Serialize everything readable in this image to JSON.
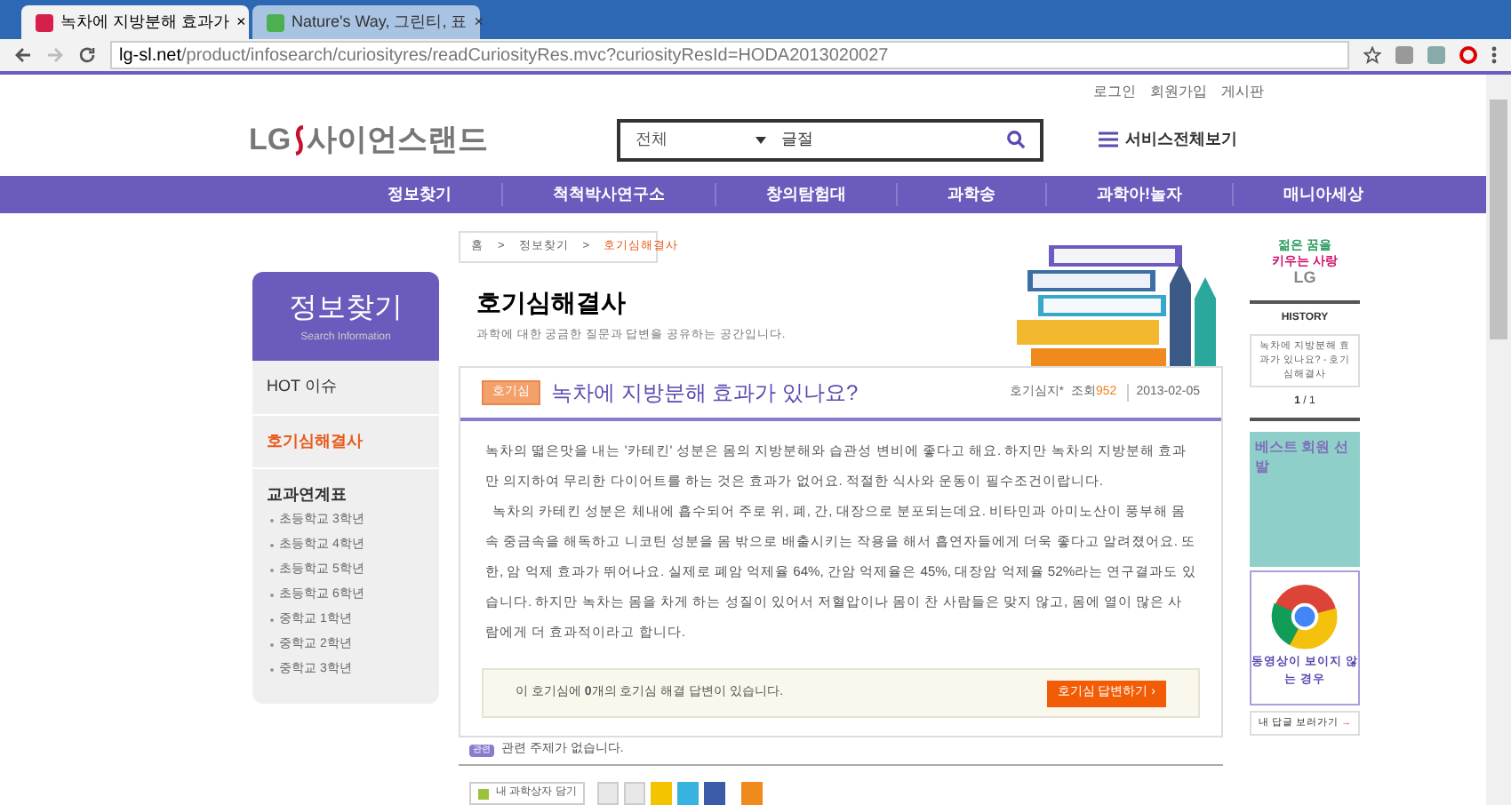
{
  "browser": {
    "tabs": [
      {
        "title": "녹차에 지방분해 효과가",
        "selected": true
      },
      {
        "title": "Nature's Way, 그린티, 표",
        "selected": false
      }
    ],
    "close_glyph": "×",
    "url_host": "lg-sl.net",
    "url_path": "/product/infosearch/curiosityres/readCuriosityRes.mvc?curiosityResId=HODA2013020027"
  },
  "top_links": [
    "로그인",
    "회원가입",
    "게시판"
  ],
  "logo": {
    "brand": "LG",
    "name": "사이언스랜드"
  },
  "search": {
    "category": "전체",
    "value": "글절"
  },
  "service_menu": "서비스전체보기",
  "nav": [
    {
      "label": "정보찾기"
    },
    {
      "label": "척척박사연구소"
    },
    {
      "label": "창의탐험대"
    },
    {
      "label": "과학송"
    },
    {
      "label": "과학아!놀자"
    },
    {
      "label": "매니아세상"
    }
  ],
  "sidebar": {
    "title": "정보찾기",
    "subtitle": "Search Information",
    "items": [
      {
        "label": "HOT 이슈",
        "selected": false
      },
      {
        "label": "호기심해결사",
        "selected": true
      },
      {
        "label": "교과연계표",
        "selected": false,
        "children": [
          {
            "label": "초등학교 3학년"
          },
          {
            "label": "초등학교 4학년"
          },
          {
            "label": "초등학교 5학년"
          },
          {
            "label": "초등학교 6학년"
          },
          {
            "label": "중학교 1학년"
          },
          {
            "label": "중학교 2학년"
          },
          {
            "label": "중학교 3학년"
          }
        ]
      }
    ]
  },
  "breadcrumb": {
    "items": [
      "홈",
      "정보찾기",
      "호기심해결사"
    ],
    "separator": ">"
  },
  "page_title": "호기심해결사",
  "page_subtitle": "과학에 대한 궁금한 질문과 답변을 공유하는 공간입니다.",
  "article": {
    "badge": "호기심",
    "title": "녹차에 지방분해 효과가 있나요?",
    "author": "호기심지*",
    "views_label": "조회",
    "views": "952",
    "date": "2013-02-05",
    "paragraphs": [
      "녹차의 떫은맛을 내는 '카테킨' 성분은 몸의 지방분해와 습관성 변비에 좋다고 해요. 하지만 녹차의 지방분해 효과만 의지하여 무리한 다이어트를 하는 것은 효과가 없어요. 적절한 식사와 운동이 필수조건이랍니다.",
      "녹차의 카테킨 성분은 체내에 흡수되어 주로 위, 폐, 간, 대장으로 분포되는데요. 비타민과 아미노산이 풍부해 몸속 중금속을 해독하고 니코틴 성분을 몸 밖으로 배출시키는 작용을 해서 흡연자들에게 더욱 좋다고 알려졌어요. 또한, 암 억제 효과가 뛰어나요. 실제로 폐암 억제율 64%, 간암 억제율은 45%, 대장암 억제율 52%라는 연구결과도 있습니다. 하지만 녹차는 몸을 차게 하는 성질이 있어서 저혈압이나 몸이 찬 사람들은 맞지 않고, 몸에 열이 많은 사람에게 더 효과적이라고 합니다."
    ],
    "answer_notice": "이 호기심에 **0**개의 호기심 해결 답변이 있습니다.",
    "answer_button": "호기심 답변하기 ›"
  },
  "related": {
    "tag": "관련",
    "text": "관련 주제가 없습니다."
  },
  "scrap_button": "내 과학상자 담기",
  "right": {
    "slogan": [
      "젊은 꿈을",
      "키우는 사랑"
    ],
    "slogan_brand": "LG",
    "history_title": "HISTORY",
    "history_item": "녹차에 지방분해 효과가 있나요? - 호기심해결사",
    "page_current": "1",
    "page_total": "/ 1",
    "banner_text": "베스트 회원 선발",
    "help_text": "동영상이 보이지 않는 경우",
    "my_answers": "내 답글 보러가기",
    "arrow": "→"
  }
}
